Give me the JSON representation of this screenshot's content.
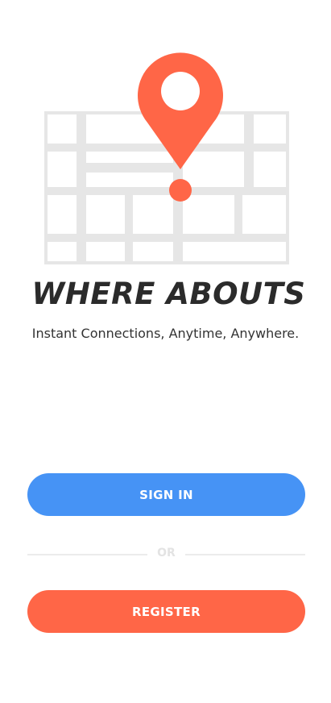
{
  "app": {
    "title": "WHERE ABOUTS",
    "tagline": "Instant Connections, Anytime, Anywhere."
  },
  "logo": {
    "icon": "map-pin-icon",
    "pin_color": "#ff6647",
    "map_color": "#e6e6e6"
  },
  "actions": {
    "sign_in_label": "SIGN IN",
    "divider_label": "OR",
    "register_label": "REGISTER"
  },
  "colors": {
    "primary_blue": "#4693f5",
    "primary_orange": "#ff6647",
    "title_text": "#2b2b2b"
  }
}
